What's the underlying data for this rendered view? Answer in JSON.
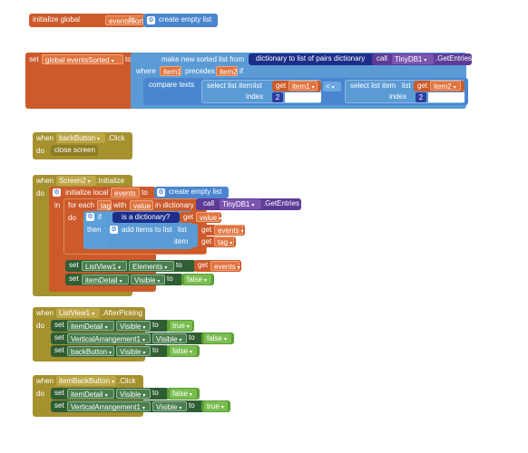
{
  "blocks": {
    "init_global": {
      "keyword": "initialize global",
      "name": "eventsSorted",
      "to": "to",
      "create_empty_list": "create empty list"
    },
    "set_global": {
      "set": "set",
      "var": "global eventsSorted",
      "to": "to",
      "make_sorted": "make new sorted list from",
      "dict_to_pairs": "dictionary to list of pairs",
      "dictionary": "dictionary",
      "call": "call",
      "component": "TinyDB1",
      "method": ".GetEntries",
      "where": "where",
      "item1": "item1",
      "precedes": "precedes",
      "item2": "item2",
      "if": "if",
      "compare_texts": "compare texts",
      "select_list_item": "select list item",
      "list": "list",
      "get": "get",
      "index": "index",
      "lt": "<",
      "index_value": "2"
    },
    "back_click": {
      "when": "when",
      "component": "backButton",
      "event": ".Click",
      "do": "do",
      "close_screen": "close screen"
    },
    "screen_init": {
      "when": "when",
      "component": "Screen2",
      "event": ".Initialize",
      "do": "do",
      "init_local": "initialize local",
      "local_name": "events",
      "to": "to",
      "create_empty_list": "create empty list",
      "in": "in",
      "for_each": "for each",
      "tag": "tag",
      "with": "with",
      "value": "value",
      "in_dictionary": "in dictionary",
      "call": "call",
      "db": "TinyDB1",
      "get_entries": ".GetEntries",
      "do2": "do",
      "if": "if",
      "is_dictionary": "is a dictionary?",
      "get": "get",
      "then": "then",
      "add_items": "add items to list",
      "list": "list",
      "item": "item",
      "set": "set",
      "listview": "ListView1",
      "elements": "Elements",
      "to2": "to",
      "item_detail": "itemDetail",
      "visible": "Visible",
      "false": "false"
    },
    "listview_pick": {
      "when": "when",
      "component": "ListView1",
      "event": ".AfterPicking",
      "do": "do",
      "set": "set",
      "rows": [
        {
          "comp": "itemDetail",
          "prop": "Visible",
          "value": "true"
        },
        {
          "comp": "VerticalArrangement1",
          "prop": "Visible",
          "value": "false"
        },
        {
          "comp": "backButton",
          "prop": "Visible",
          "value": "false"
        }
      ],
      "to": "to"
    },
    "itemback_click": {
      "when": "when",
      "component": "itemBackButton",
      "event": ".Click",
      "do": "do",
      "set": "set",
      "rows": [
        {
          "comp": "itemDetail",
          "prop": "Visible",
          "value": "false"
        },
        {
          "comp": "VerticalArrangement1",
          "prop": "Visible",
          "value": "true"
        }
      ],
      "to": "to"
    }
  }
}
